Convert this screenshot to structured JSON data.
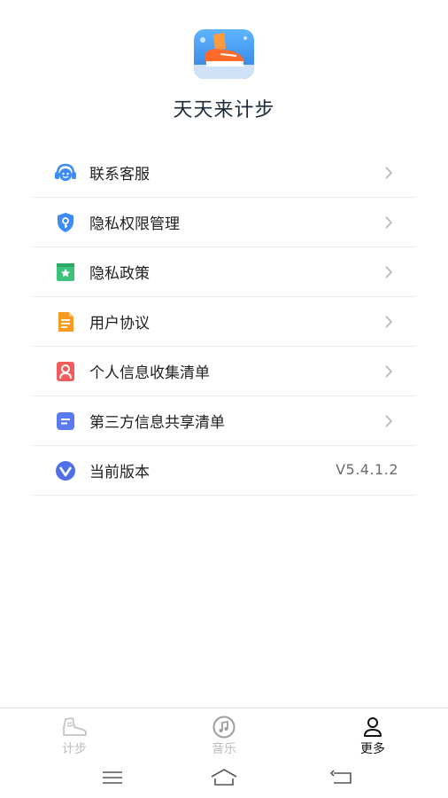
{
  "app": {
    "title": "天天来计步"
  },
  "menu": {
    "items": [
      {
        "label": "联系客服",
        "icon": "customer-service-icon"
      },
      {
        "label": "隐私权限管理",
        "icon": "privacy-shield-icon"
      },
      {
        "label": "隐私政策",
        "icon": "policy-bookmark-icon"
      },
      {
        "label": "用户协议",
        "icon": "user-agreement-icon"
      },
      {
        "label": "个人信息收集清单",
        "icon": "personal-info-icon"
      },
      {
        "label": "第三方信息共享清单",
        "icon": "third-party-share-icon"
      },
      {
        "label": "当前版本",
        "icon": "version-icon",
        "value": "V5.4.1.2"
      }
    ]
  },
  "tabbar": {
    "tabs": [
      {
        "label": "计步",
        "icon": "shoe-icon",
        "active": false
      },
      {
        "label": "音乐",
        "icon": "music-icon",
        "active": false
      },
      {
        "label": "更多",
        "icon": "profile-icon",
        "active": true
      }
    ]
  },
  "colors": {
    "accent_blue": "#3d8bf7",
    "green": "#3cc27a",
    "orange": "#f59a23",
    "red": "#f25c5c",
    "indigo": "#5a7bf0"
  }
}
